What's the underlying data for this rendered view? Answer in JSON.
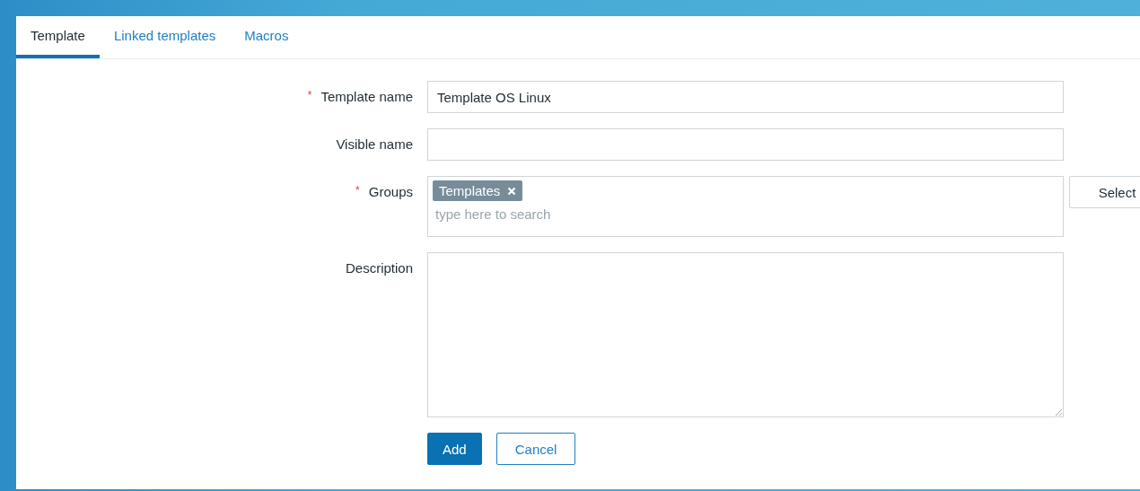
{
  "tabs": [
    {
      "label": "Template",
      "selected": true
    },
    {
      "label": "Linked templates",
      "selected": false
    },
    {
      "label": "Macros",
      "selected": false
    }
  ],
  "form": {
    "fields": [
      {
        "kind": "text",
        "label": "Template name",
        "required_mark": "*",
        "value": "Template OS Linux"
      },
      {
        "kind": "text",
        "label": "Visible name"
      },
      {
        "kind": "multiselect",
        "label": "Groups",
        "required_mark": "*",
        "tags": [
          "Templates"
        ],
        "placeholder": "type here to search",
        "button": "Select"
      },
      {
        "kind": "textarea",
        "label": "Description"
      }
    ],
    "buttons": [
      {
        "label": "Add",
        "kind": "primary"
      },
      {
        "label": "Cancel",
        "kind": "secondary"
      }
    ]
  }
}
